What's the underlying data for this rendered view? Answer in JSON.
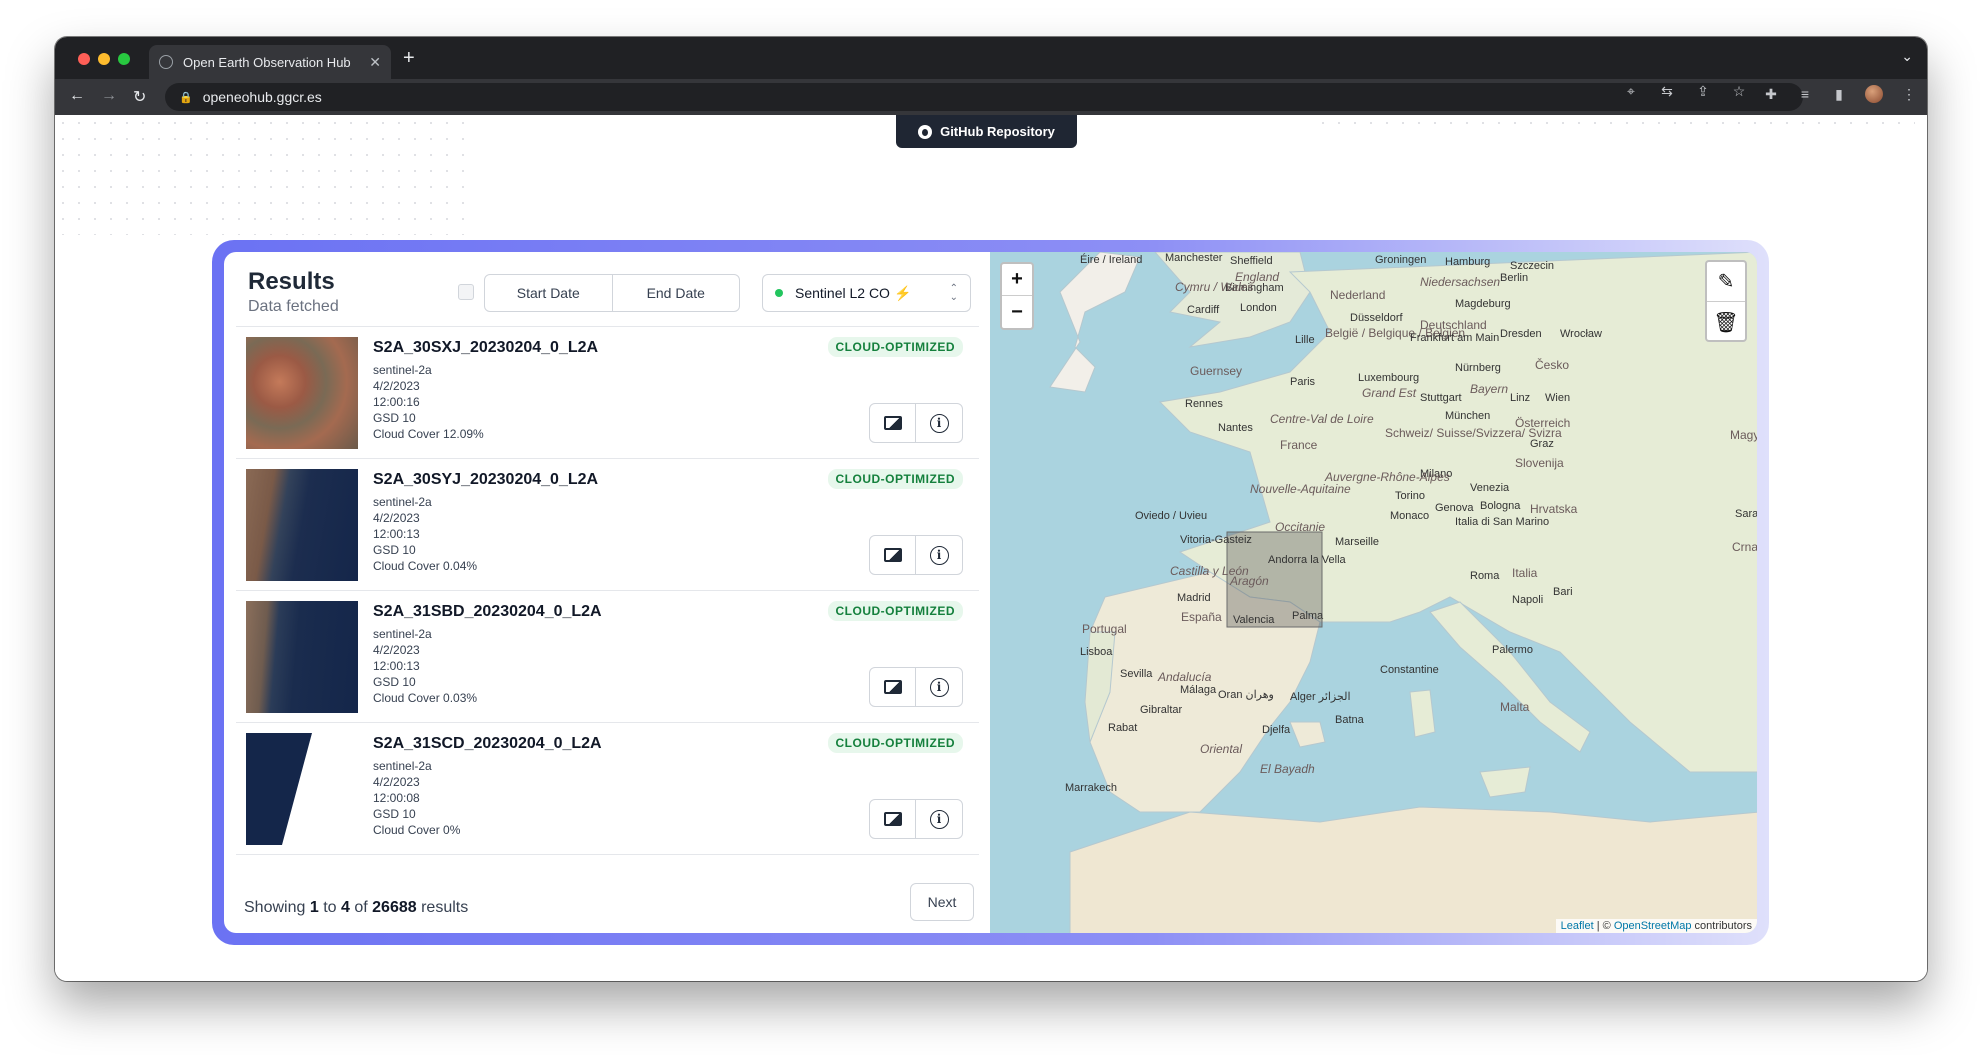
{
  "browser": {
    "tab_title": "Open Earth Observation Hub",
    "url": "openeohub.ggcr.es"
  },
  "page": {
    "github_button": "GitHub Repository"
  },
  "panel": {
    "title": "Results",
    "subtitle": "Data fetched",
    "start_date": "Start Date",
    "end_date": "End Date",
    "collection": "Sentinel L2 CO",
    "collection_bolt": "⚡"
  },
  "results": [
    {
      "name": "S2A_30SXJ_20230204_0_L2A",
      "platform": "sentinel-2a",
      "date": "4/2/2023",
      "time": "12:00:16",
      "gsd": "GSD 10",
      "cloud": "Cloud Cover 12.09%",
      "badge": "CLOUD-OPTIMIZED"
    },
    {
      "name": "S2A_30SYJ_20230204_0_L2A",
      "platform": "sentinel-2a",
      "date": "4/2/2023",
      "time": "12:00:13",
      "gsd": "GSD 10",
      "cloud": "Cloud Cover 0.04%",
      "badge": "CLOUD-OPTIMIZED"
    },
    {
      "name": "S2A_31SBD_20230204_0_L2A",
      "platform": "sentinel-2a",
      "date": "4/2/2023",
      "time": "12:00:13",
      "gsd": "GSD 10",
      "cloud": "Cloud Cover 0.03%",
      "badge": "CLOUD-OPTIMIZED"
    },
    {
      "name": "S2A_31SCD_20230204_0_L2A",
      "platform": "sentinel-2a",
      "date": "4/2/2023",
      "time": "12:00:08",
      "gsd": "GSD 10",
      "cloud": "Cloud Cover 0%",
      "badge": "CLOUD-OPTIMIZED"
    }
  ],
  "pagination": {
    "showing": "Showing",
    "from": "1",
    "to_word": "to",
    "to": "4",
    "of_word": "of",
    "total": "26688",
    "results_word": "results",
    "next": "Next"
  },
  "map": {
    "zoom_in": "+",
    "zoom_out": "−",
    "attribution_leaflet": "Leaflet",
    "attribution_sep": " | © ",
    "attribution_osm": "OpenStreetMap",
    "attribution_tail": " contributors",
    "labels": [
      "Éire / Ireland",
      "Manchester",
      "Sheffield",
      "England",
      "Birmingham",
      "Cymru / Wales",
      "Cardiff",
      "London",
      "Nederland",
      "Groningen",
      "Hamburg",
      "Szczecin",
      "Berlin",
      "Niedersachsen",
      "Düsseldorf",
      "Magdeburg",
      "Deutschland",
      "Lille",
      "België / Belgique / Belgien",
      "Frankfurt am Main",
      "Dresden",
      "Wrocław",
      "Guernsey",
      "Paris",
      "Luxembourg",
      "Grand Est",
      "Nürnberg",
      "Česko",
      "Rennes",
      "Stuttgart",
      "Bayern",
      "Linz",
      "Wien",
      "Nantes",
      "Centre-Val de Loire",
      "München",
      "Österreich",
      "France",
      "Schweiz/ Suisse/Svizzera/ Svizra",
      "Magy",
      "Graz",
      "Slovenija",
      "Milano",
      "Nouvelle-Aquitaine",
      "Auvergne-Rhône-Alpes",
      "Venezia",
      "Torino",
      "Oviedo / Uvieu",
      "Genova",
      "Bologna",
      "Hrvatska",
      "Monaco",
      "Occitanie",
      "Italia di San Marino",
      "Saraje",
      "Vitoria-Gasteiz",
      "Marseille",
      "Andorra la Vella",
      "Castilla y León",
      "Aragón",
      "Crna Горa",
      "Roma",
      "Italia",
      "Madrid",
      "Portugal",
      "España",
      "Bari",
      "Valencia",
      "Palma",
      "Napoli",
      "Lisboa",
      "Sevilla",
      "Andalucía",
      "Palermo",
      "Constantine",
      "Málaga",
      "Oran وهران",
      "Alger الجزائر",
      "Gibraltar",
      "Malta",
      "Rabat",
      "Batna",
      "Djelfa",
      "Oriental",
      "El Bayadh",
      "Marrakech"
    ],
    "drawn_box": "selected area"
  }
}
